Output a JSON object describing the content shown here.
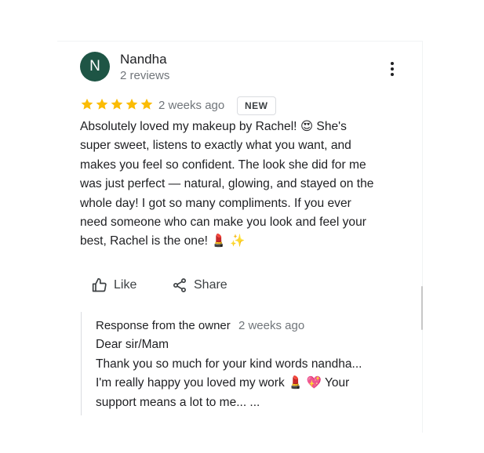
{
  "review": {
    "author_initial": "N",
    "author_name": "Nandha",
    "author_reviews": "2 reviews",
    "rating": 5,
    "rating_max": 5,
    "date": "2 weeks ago",
    "badge": "NEW",
    "text": "Absolutely loved my makeup by Rachel! 😍 She's\nsuper sweet, listens to exactly what you want, and\nmakes you feel so confident. The look she did for me\nwas just perfect — natural, glowing, and stayed on the\nwhole day! I got so many compliments. If you ever\nneed someone who can make you look and feel your\nbest, Rachel is the one! 💄 ✨"
  },
  "actions": {
    "like_label": "Like",
    "share_label": "Share"
  },
  "owner_response": {
    "title": "Response from the owner",
    "date": "2 weeks ago",
    "text": "Dear sir/Mam\nThank you so much for your kind words nandha...\nI'm really happy you loved my work 💄 💖 Your\nsupport means a lot to me...  ..."
  },
  "colors": {
    "avatar_bg": "#1e5545",
    "star": "#fbbc04",
    "text_primary": "#202124",
    "text_secondary": "#70757a"
  }
}
